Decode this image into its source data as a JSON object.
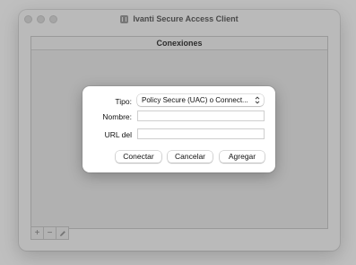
{
  "window": {
    "title": "Ivanti Secure Access Client"
  },
  "panel": {
    "header": "Conexiones"
  },
  "toolbar": {
    "add_label": "+",
    "remove_label": "−"
  },
  "dialog": {
    "type_label": "Tipo:",
    "type_value": "Policy Secure (UAC) o Connect...",
    "name_label": "Nombre:",
    "name_value": "",
    "url_label": "URL del",
    "url_value": "",
    "connect_label": "Conectar",
    "cancel_label": "Cancelar",
    "add_label": "Agregar"
  }
}
